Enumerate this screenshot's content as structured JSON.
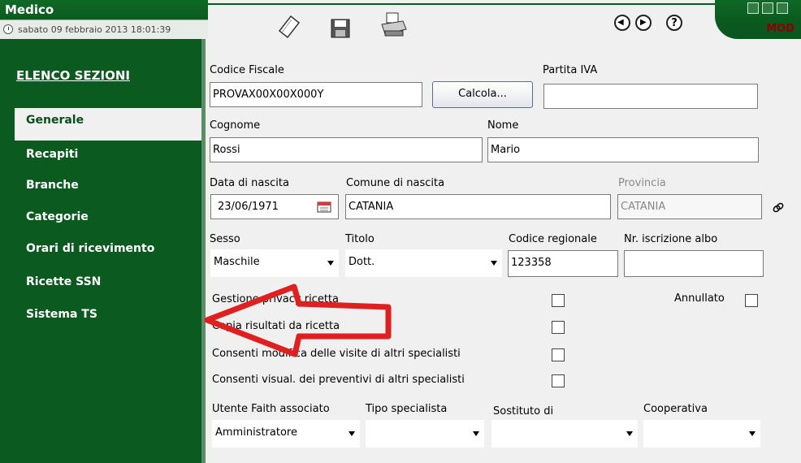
{
  "window": {
    "app_name": "Medico",
    "datetime": "sabato 09 febbraio 2013   18:01:39",
    "mode": "MOD"
  },
  "toolbar": {
    "icons": [
      "new-document-icon",
      "save-icon",
      "printer-icon",
      "back-icon",
      "forward-icon",
      "help-icon"
    ],
    "help_glyph": "?"
  },
  "sidebar": {
    "heading": "ELENCO SEZIONI",
    "items": [
      {
        "label": "Generale",
        "active": true
      },
      {
        "label": "Recapiti"
      },
      {
        "label": "Branche"
      },
      {
        "label": "Categorie"
      },
      {
        "label": "Orari di ricevimento"
      },
      {
        "label": "Ricette SSN"
      },
      {
        "label": "Sistema TS"
      }
    ]
  },
  "form": {
    "codice_fiscale": {
      "label": "Codice Fiscale",
      "value": "PROVAX00X00X000Y"
    },
    "calcola_button": "Calcola...",
    "partita_iva": {
      "label": "Partita IVA",
      "value": ""
    },
    "cognome": {
      "label": "Cognome",
      "value": "Rossi"
    },
    "nome": {
      "label": "Nome",
      "value": "Mario"
    },
    "data_nascita": {
      "label": "Data di nascita",
      "value": "23/06/1971"
    },
    "comune_nascita": {
      "label": "Comune di nascita",
      "value": "CATANIA"
    },
    "provincia": {
      "label": "Provincia",
      "value": "CATANIA"
    },
    "sesso": {
      "label": "Sesso",
      "value": "Maschile"
    },
    "titolo": {
      "label": "Titolo",
      "value": "Dott."
    },
    "codice_regionale": {
      "label": "Codice regionale",
      "value": "123358"
    },
    "nr_iscrizione_albo": {
      "label": "Nr. iscrizione albo",
      "value": ""
    },
    "checkboxes": [
      {
        "label": "Gestione privacy ricetta",
        "checked": false
      },
      {
        "label": "Copia risultati da ricetta",
        "checked": false
      },
      {
        "label": "Consenti modifica delle visite di altri specialisti",
        "checked": false
      },
      {
        "label": "Consenti visual. dei preventivi di altri specialisti",
        "checked": false
      }
    ],
    "annullato": {
      "label": "Annullato",
      "checked": false
    },
    "utente_faith": {
      "label": "Utente Faith associato",
      "value": "Amministratore"
    },
    "tipo_specialista": {
      "label": "Tipo specialista",
      "value": ""
    },
    "sostituto_di": {
      "label": "Sostituto di",
      "value": ""
    },
    "cooperativa": {
      "label": "Cooperativa",
      "value": ""
    }
  },
  "annotation": {
    "color": "#e02020",
    "shape": "arrow-pointing-left"
  }
}
